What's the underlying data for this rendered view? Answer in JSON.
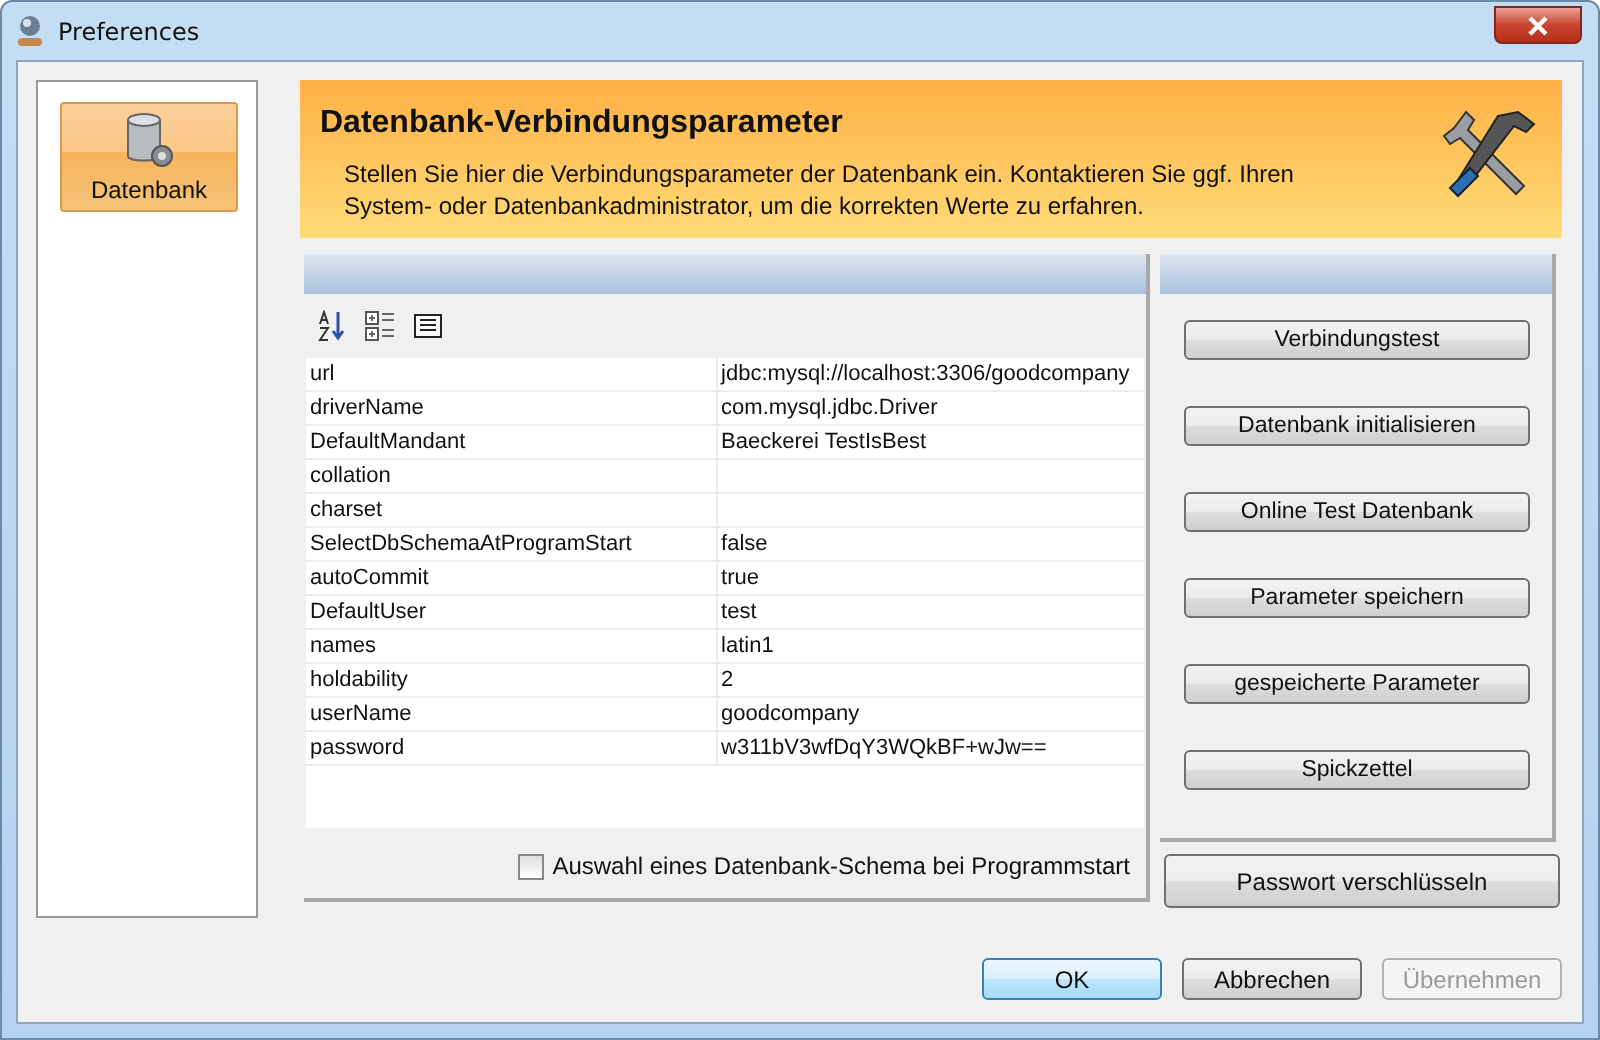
{
  "window": {
    "title": "Preferences"
  },
  "sidebar": {
    "items": [
      {
        "label": "Datenbank",
        "selected": true
      }
    ]
  },
  "header": {
    "title": "Datenbank-Verbindungsparameter",
    "description": "Stellen Sie hier die Verbindungsparameter der Datenbank ein. Kontaktieren Sie ggf. Ihren System- oder Datenbankadministrator, um die korrekten Werte zu erfahren."
  },
  "properties": [
    {
      "name": "url",
      "value": "jdbc:mysql://localhost:3306/goodcompany"
    },
    {
      "name": "driverName",
      "value": "com.mysql.jdbc.Driver"
    },
    {
      "name": "DefaultMandant",
      "value": "Baeckerei TestIsBest"
    },
    {
      "name": "collation"
    },
    {
      "name": "charset"
    },
    {
      "name": "SelectDbSchemaAtProgramStart",
      "value": "false"
    },
    {
      "name": "autoCommit",
      "value": "true"
    },
    {
      "name": "DefaultUser",
      "value": "test"
    },
    {
      "name": "names",
      "value": "latin1"
    },
    {
      "name": "holdability",
      "value": "2"
    },
    {
      "name": "userName",
      "value": "goodcompany"
    },
    {
      "name": "password",
      "value": "w311bV3wfDqY3WQkBF+wJw=="
    }
  ],
  "schema_checkbox": {
    "label": "Auswahl eines Datenbank-Schema bei Programmstart",
    "checked": false
  },
  "actions": [
    "Verbindungstest",
    "Datenbank initialisieren",
    "Online Test Datenbank",
    "Parameter speichern",
    "gespeicherte Parameter",
    "Spickzettel"
  ],
  "encrypt_button": "Passwort verschlüsseln",
  "dialog_buttons": [
    {
      "label": "OK",
      "disabled": false,
      "default": true
    },
    {
      "label": "Abbrechen",
      "disabled": false,
      "default": false
    },
    {
      "label": "Übernehmen",
      "disabled": true,
      "default": false
    }
  ]
}
